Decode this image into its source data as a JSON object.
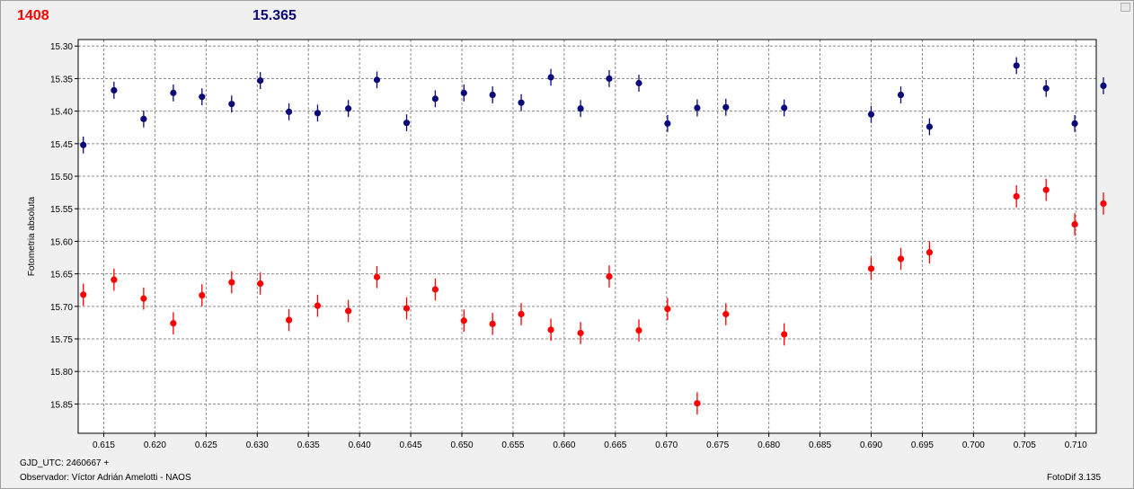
{
  "header": {
    "red_value": "1408",
    "blue_value": "15.365"
  },
  "footer": {
    "gjd": "GJD_UTC: 2460667 +",
    "observer": "Observador: Víctor Adrián Amelotti - NAOS",
    "version": "FotoDif 3.135"
  },
  "colors": {
    "red_series": "#ff0000",
    "blue_series": "#0a0a78",
    "grid": "#8a8a8a",
    "background": "#ffffff"
  },
  "chart_data": {
    "type": "scatter",
    "title": "",
    "xlabel": "",
    "ylabel": "Fotometria absoluta",
    "xlim": [
      0.6125,
      0.712
    ],
    "ylim": [
      15.29,
      15.895
    ],
    "y_inverted": true,
    "grid": true,
    "x_ticks": [
      0.615,
      0.62,
      0.625,
      0.63,
      0.635,
      0.64,
      0.645,
      0.65,
      0.655,
      0.66,
      0.665,
      0.67,
      0.675,
      0.68,
      0.685,
      0.69,
      0.695,
      0.7,
      0.705,
      0.71
    ],
    "x_tick_labels": [
      "0.615",
      "0.620",
      "0.625",
      "0.630",
      "0.635",
      "0.640",
      "0.645",
      "0.650",
      "0.655",
      "0.660",
      "0.665",
      "0.670",
      "0.675",
      "0.680",
      "0.685",
      "0.690",
      "0.695",
      "0.700",
      "0.705",
      "0.710"
    ],
    "y_ticks": [
      15.3,
      15.35,
      15.4,
      15.45,
      15.5,
      15.55,
      15.6,
      15.65,
      15.7,
      15.75,
      15.8,
      15.85
    ],
    "y_tick_labels": [
      "15.30",
      "15.35",
      "15.40",
      "15.45",
      "15.50",
      "15.55",
      "15.60",
      "15.65",
      "15.70",
      "15.75",
      "15.80",
      "15.85"
    ],
    "series": [
      {
        "color": "#0a0a78",
        "error": 0.013,
        "x": [
          0.613,
          0.616,
          0.6189,
          0.6218,
          0.6246,
          0.6275,
          0.6303,
          0.6331,
          0.6359,
          0.6389,
          0.6417,
          0.6446,
          0.6474,
          0.6502,
          0.653,
          0.6558,
          0.6587,
          0.6616,
          0.6644,
          0.6673,
          0.6701,
          0.673,
          0.6758,
          0.6815,
          0.69,
          0.6929,
          0.6957,
          0.7042,
          0.7071,
          0.7099,
          0.7127
        ],
        "y": [
          15.452,
          15.368,
          15.412,
          15.372,
          15.378,
          15.389,
          15.353,
          15.401,
          15.403,
          15.396,
          15.352,
          15.418,
          15.381,
          15.372,
          15.375,
          15.387,
          15.348,
          15.396,
          15.35,
          15.357,
          15.419,
          15.395,
          15.394,
          15.395,
          15.405,
          15.375,
          15.424,
          15.33,
          15.365,
          15.419,
          15.361
        ]
      },
      {
        "color": "#ff0000",
        "error": 0.017,
        "x": [
          0.613,
          0.616,
          0.6189,
          0.6218,
          0.6246,
          0.6275,
          0.6303,
          0.6331,
          0.6359,
          0.6389,
          0.6417,
          0.6446,
          0.6474,
          0.6502,
          0.653,
          0.6558,
          0.6587,
          0.6616,
          0.6644,
          0.6673,
          0.6701,
          0.673,
          0.6758,
          0.6815,
          0.69,
          0.6929,
          0.6957,
          0.7042,
          0.7071,
          0.7099,
          0.7127
        ],
        "y": [
          15.682,
          15.659,
          15.688,
          15.726,
          15.683,
          15.663,
          15.665,
          15.721,
          15.699,
          15.707,
          15.655,
          15.703,
          15.674,
          15.722,
          15.727,
          15.712,
          15.736,
          15.741,
          15.654,
          15.737,
          15.704,
          15.849,
          15.712,
          15.743,
          15.642,
          15.627,
          15.617,
          15.531,
          15.521,
          15.574,
          15.542
        ]
      }
    ]
  }
}
